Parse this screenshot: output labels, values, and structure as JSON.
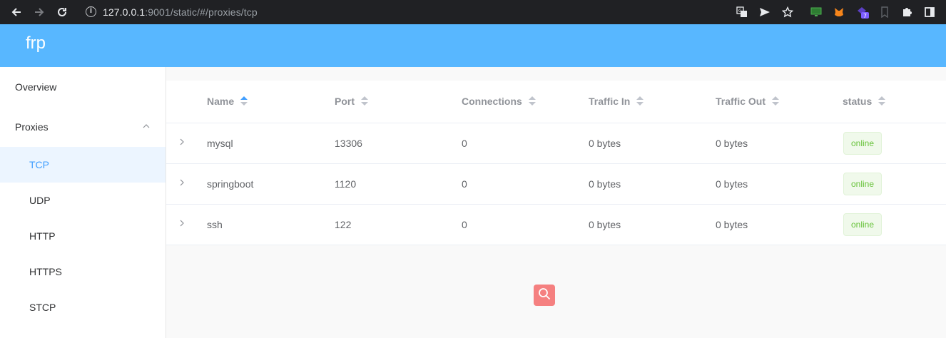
{
  "browser": {
    "url_host": "127.0.0.1",
    "url_rest": ":9001/static/#/proxies/tcp",
    "extension_badge": "7"
  },
  "app": {
    "brand": "frp"
  },
  "sidebar": {
    "overview": "Overview",
    "proxies": "Proxies",
    "sub_items": [
      "TCP",
      "UDP",
      "HTTP",
      "HTTPS",
      "STCP"
    ],
    "active": "TCP"
  },
  "table": {
    "headers": [
      "Name",
      "Port",
      "Connections",
      "Traffic In",
      "Traffic Out",
      "status"
    ],
    "sorted_column": "Name",
    "sort_order": "ascending",
    "rows": [
      {
        "name": "mysql",
        "port": "13306",
        "connections": "0",
        "traffic_in": "0 bytes",
        "traffic_out": "0 bytes",
        "status": "online"
      },
      {
        "name": "springboot",
        "port": "1120",
        "connections": "0",
        "traffic_in": "0 bytes",
        "traffic_out": "0 bytes",
        "status": "online"
      },
      {
        "name": "ssh",
        "port": "122",
        "connections": "0",
        "traffic_in": "0 bytes",
        "traffic_out": "0 bytes",
        "status": "online"
      }
    ]
  },
  "colors": {
    "header": "#58b7ff",
    "active_menu": "#409eff",
    "status_online": "#67c23a",
    "search_button": "#f56c6c"
  }
}
